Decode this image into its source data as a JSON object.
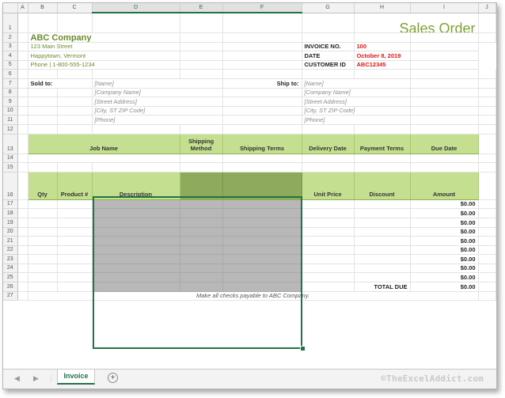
{
  "columns": [
    "A",
    "B",
    "C",
    "D",
    "E",
    "F",
    "G",
    "H",
    "I",
    "J"
  ],
  "rows": [
    "1",
    "2",
    "3",
    "4",
    "5",
    "6",
    "7",
    "8",
    "9",
    "10",
    "11",
    "12",
    "13",
    "14",
    "15",
    "16",
    "17",
    "18",
    "19",
    "20",
    "21",
    "22",
    "23",
    "24",
    "25",
    "26",
    "27"
  ],
  "title": "Sales Order",
  "company": {
    "name": "ABC Company",
    "street": "123 Main Street",
    "city": "Happytown, Vermont",
    "phone": "Phone | 1-800-555-1234"
  },
  "meta": [
    {
      "label": "INVOICE NO.",
      "value": "100"
    },
    {
      "label": "DATE",
      "value": "October 8, 2019"
    },
    {
      "label": "CUSTOMER ID",
      "value": "ABC12345"
    }
  ],
  "sold_to": {
    "label": "Sold to:",
    "lines": [
      "[Name]",
      "[Company Name]",
      "[Street Address]",
      "[City, ST  ZIP Code]",
      "[Phone]"
    ]
  },
  "ship_to": {
    "label": "Ship to:",
    "lines": [
      "[Name]",
      "[Company Name]",
      "[Street Address]",
      "[City, ST  ZIP Code]",
      "[Phone]"
    ]
  },
  "job_header": {
    "job_name": "Job Name",
    "shipping_method": "Shipping Method",
    "shipping_terms": "Shipping Terms",
    "delivery_date": "Delivery Date",
    "payment_terms": "Payment Terms",
    "due_date": "Due Date"
  },
  "items_header": {
    "qty": "Qty",
    "product": "Product #",
    "description": "Description",
    "unit_price": "Unit Price",
    "discount": "Discount",
    "amount": "Amount"
  },
  "line_amounts": [
    "$0.00",
    "$0.00",
    "$0.00",
    "$0.00",
    "$0.00",
    "$0.00",
    "$0.00",
    "$0.00",
    "$0.00"
  ],
  "total": {
    "label": "TOTAL DUE",
    "value": "$0.00"
  },
  "note": "Make all checks payable to ABC Company.",
  "sheet_tab": "Invoice",
  "watermark": "©TheExcelAddict.com"
}
